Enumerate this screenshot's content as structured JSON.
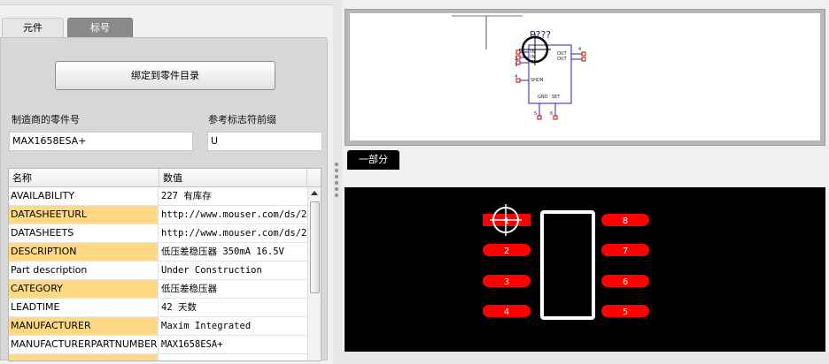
{
  "tabs": [
    {
      "label": "元件"
    },
    {
      "label": "标号"
    }
  ],
  "bind_button": {
    "label": "绑定到零件目录"
  },
  "manufacturer_pn": {
    "label": "制造商的零件号",
    "value": "MAX1658ESA+"
  },
  "ref_prefix": {
    "label": "参考标志符前缀",
    "value": "U"
  },
  "table": {
    "headers": [
      "名称",
      "数值"
    ],
    "rows": [
      {
        "name": "AVAILABILITY",
        "value": "227 有库存"
      },
      {
        "name": "DATASHEETURL",
        "value": "http://www.mouser.com/ds/2"
      },
      {
        "name": "DATASHEETS",
        "value": "http://www.mouser.com/ds/2"
      },
      {
        "name": "DESCRIPTION",
        "value": "低压差稳压器 350mA 16.5V"
      },
      {
        "name": "Part description",
        "value": "Under Construction"
      },
      {
        "name": "CATEGORY",
        "value": "低压差稳压器"
      },
      {
        "name": "LEADTIME",
        "value": "42 天数"
      },
      {
        "name": "MANUFACTURER",
        "value": "Maxim Integrated"
      },
      {
        "name": "MANUFACTURERPARTNUMBER",
        "value": "MAX1658ESA+"
      }
    ]
  },
  "schematic": {
    "refdes": "P???",
    "pin_labels": {
      "in1": "IN",
      "in2": "IN",
      "in3": "IN",
      "out1": "OUT",
      "out2": "OUT",
      "shdn": "SHDN",
      "gnd": "GND",
      "set": "SET"
    },
    "pin_numbers": {
      "left1": "2",
      "left2": "3",
      "shdn": "4",
      "right": "4",
      "bot1": "5",
      "bot2": "6"
    }
  },
  "part_tab": {
    "label": "一部分"
  },
  "footprint": {
    "left_pads": [
      "1",
      "2",
      "3",
      "4"
    ],
    "right_pads": [
      "8",
      "7",
      "6",
      "5"
    ],
    "pad_color": "#ff0000",
    "outline_color": "#ffffff",
    "background": "#000000"
  }
}
